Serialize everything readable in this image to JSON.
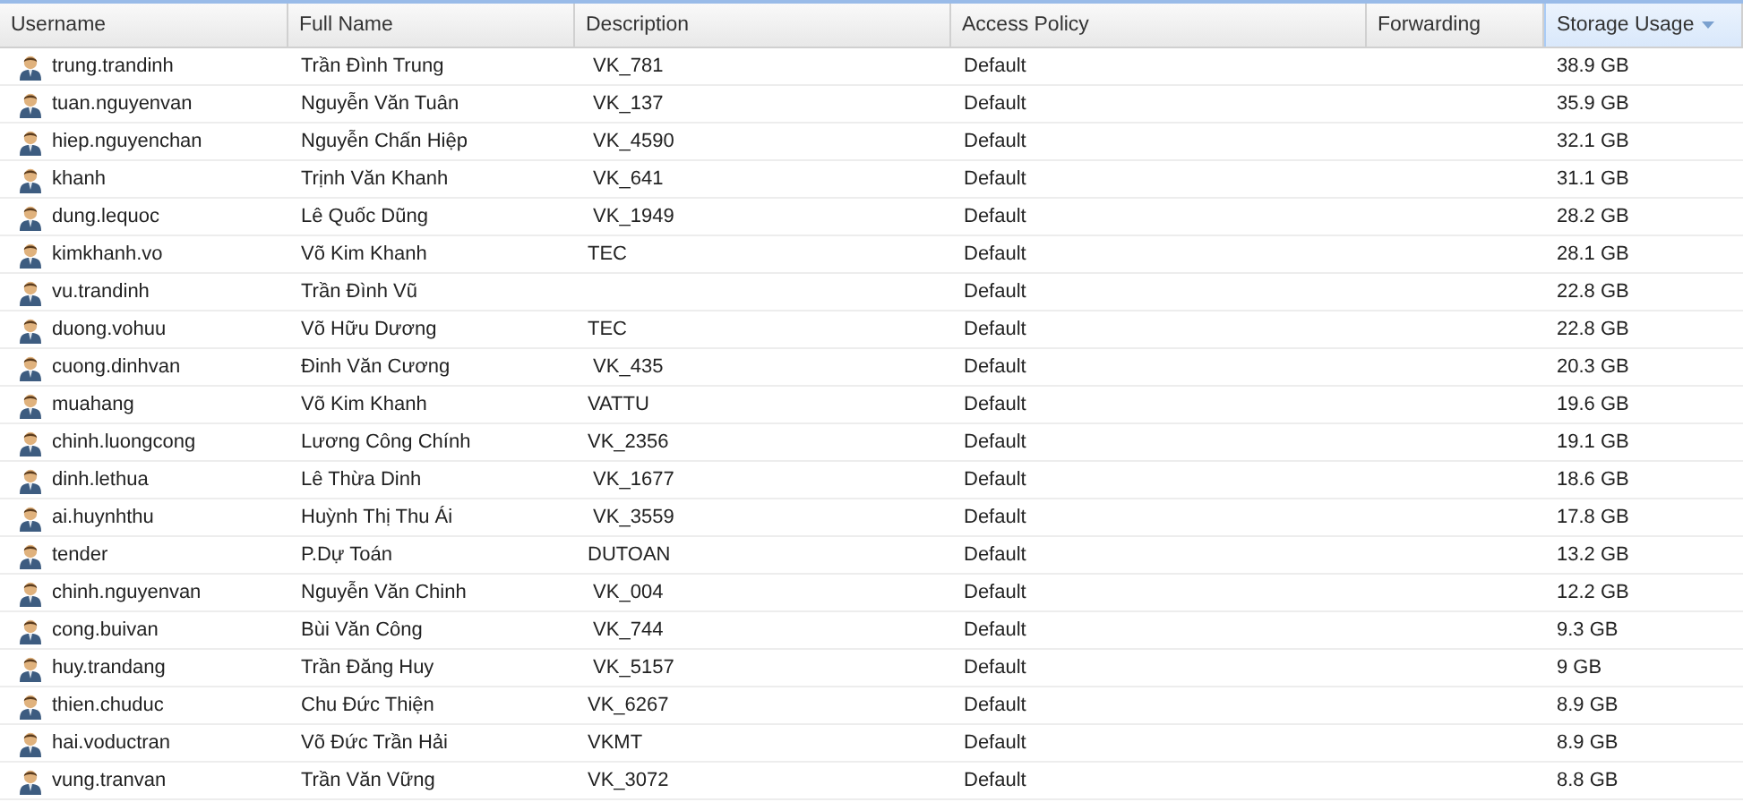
{
  "table": {
    "columns": [
      {
        "label": "Username",
        "sorted": false
      },
      {
        "label": "Full Name",
        "sorted": false
      },
      {
        "label": "Description",
        "sorted": false
      },
      {
        "label": "Access Policy",
        "sorted": false
      },
      {
        "label": "Forwarding",
        "sorted": false
      },
      {
        "label": "Storage Usage",
        "sorted": true
      }
    ],
    "rows": [
      {
        "username": "trung.trandinh",
        "full_name": "Trần Đình Trung",
        "description": " VK_781",
        "access_policy": "Default",
        "storage_usage": "38.9 GB"
      },
      {
        "username": "tuan.nguyenvan",
        "full_name": "Nguyễn Văn Tuân",
        "description": " VK_137",
        "access_policy": "Default",
        "storage_usage": "35.9 GB"
      },
      {
        "username": "hiep.nguyenchan",
        "full_name": "Nguyễn Chấn Hiệp",
        "description": " VK_4590",
        "access_policy": "Default",
        "storage_usage": "32.1 GB"
      },
      {
        "username": "khanh",
        "full_name": "Trịnh Văn Khanh",
        "description": " VK_641",
        "access_policy": "Default",
        "storage_usage": "31.1 GB"
      },
      {
        "username": "dung.lequoc",
        "full_name": "Lê Quốc Dũng",
        "description": " VK_1949",
        "access_policy": "Default",
        "storage_usage": "28.2 GB"
      },
      {
        "username": "kimkhanh.vo",
        "full_name": "Võ Kim Khanh",
        "description": "TEC",
        "access_policy": "Default",
        "storage_usage": "28.1 GB"
      },
      {
        "username": "vu.trandinh",
        "full_name": "Trần Đình Vũ",
        "access_policy": "Default",
        "storage_usage": "22.8 GB"
      },
      {
        "username": "duong.vohuu",
        "full_name": "Võ Hữu Dương",
        "description": "TEC",
        "access_policy": "Default",
        "storage_usage": "22.8 GB"
      },
      {
        "username": "cuong.dinhvan",
        "full_name": "Đinh Văn Cương",
        "description": " VK_435",
        "access_policy": "Default",
        "storage_usage": "20.3 GB"
      },
      {
        "username": "muahang",
        "full_name": "Võ Kim Khanh",
        "description": "VATTU",
        "access_policy": "Default",
        "storage_usage": "19.6 GB"
      },
      {
        "username": "chinh.luongcong",
        "full_name": "Lương Công Chính",
        "description": "VK_2356",
        "access_policy": "Default",
        "storage_usage": "19.1 GB"
      },
      {
        "username": "dinh.lethua",
        "full_name": "Lê Thừa Dinh",
        "description": " VK_1677",
        "access_policy": "Default",
        "storage_usage": "18.6 GB"
      },
      {
        "username": "ai.huynhthu",
        "full_name": "Huỳnh Thị Thu Ái",
        "description": " VK_3559",
        "access_policy": "Default",
        "storage_usage": "17.8 GB"
      },
      {
        "username": "tender",
        "full_name": "P.Dự Toán",
        "description": "DUTOAN",
        "access_policy": "Default",
        "storage_usage": "13.2 GB"
      },
      {
        "username": "chinh.nguyenvan",
        "full_name": "Nguyễn Văn Chinh",
        "description": " VK_004",
        "access_policy": "Default",
        "storage_usage": "12.2 GB"
      },
      {
        "username": "cong.buivan",
        "full_name": "Bùi Văn Công",
        "description": " VK_744",
        "access_policy": "Default",
        "storage_usage": "9.3 GB"
      },
      {
        "username": "huy.trandang",
        "full_name": "Trần Đăng Huy",
        "description": " VK_5157",
        "access_policy": "Default",
        "storage_usage": "9 GB"
      },
      {
        "username": "thien.chuduc",
        "full_name": "Chu Đức Thiện",
        "description": "VK_6267",
        "access_policy": "Default",
        "storage_usage": "8.9 GB"
      },
      {
        "username": "hai.voductran",
        "full_name": "Võ Đức Trần Hải",
        "description": "VKMT",
        "access_policy": "Default",
        "storage_usage": "8.9 GB"
      },
      {
        "username": "vung.tranvan",
        "full_name": "Trần Văn Vững",
        "description": "VK_3072",
        "access_policy": "Default",
        "storage_usage": "8.8 GB"
      }
    ]
  }
}
